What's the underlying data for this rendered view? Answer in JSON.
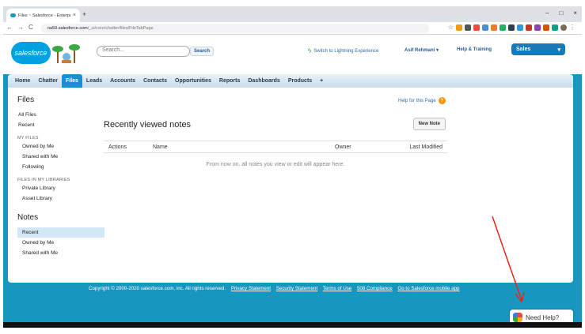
{
  "browser": {
    "tab_title": "Files ~ Salesforce - Enterprise Ed",
    "tab_close": "×",
    "new_tab": "+",
    "window_controls": [
      "–",
      "□",
      "×"
    ],
    "nav": [
      "←",
      "→",
      "C"
    ],
    "url_host": "na59.salesforce.com",
    "url_path": "/_ui/core/chatter/files/FileTabPage",
    "star": "☆",
    "menu": "⋮"
  },
  "header": {
    "logo_text": "salesforce",
    "search_placeholder": "Search...",
    "search_button": "Search",
    "switch_lightning": "Switch to Lightning Experience",
    "user_name": "Asif Rehmani",
    "help_training": "Help & Training",
    "app_menu": "Sales"
  },
  "tabs": [
    "Home",
    "Chatter",
    "Files",
    "Leads",
    "Accounts",
    "Contacts",
    "Opportunities",
    "Reports",
    "Dashboards",
    "Products",
    "+"
  ],
  "active_tab": "Files",
  "sidebar": {
    "files_title": "Files",
    "top_links": [
      "All Files",
      "Recent"
    ],
    "my_files_head": "MY FILES",
    "my_files": [
      "Owned by Me",
      "Shared with Me",
      "Following"
    ],
    "libraries_head": "FILES IN MY LIBRARIES",
    "libraries": [
      "Private Library",
      "Asset Library"
    ],
    "notes_title": "Notes",
    "notes": [
      "Recent",
      "Owned by Me",
      "Shared with Me"
    ]
  },
  "main": {
    "help_link": "Help for this Page",
    "help_icon": "?",
    "title": "Recently viewed notes",
    "new_note": "New Note",
    "columns": [
      "Actions",
      "Name",
      "Owner",
      "Last Modified"
    ],
    "empty_message": "From now on, all notes you view or edit will appear here."
  },
  "footer": {
    "copyright": "Copyright © 2000-2020 salesforce.com, inc. All rights reserved.",
    "links": [
      "Privacy Statement",
      "Security Statement",
      "Terms of Use",
      "508 Compliance",
      "Go to Salesforce mobile app"
    ]
  },
  "need_help": "Need Help?",
  "colors": {
    "page_bg": "#1797c0",
    "active_tab": "#1a8fd6",
    "annotation": "#e8261b"
  }
}
